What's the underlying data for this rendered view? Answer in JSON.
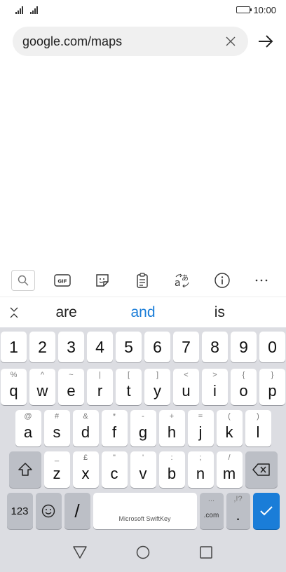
{
  "status_bar": {
    "time": "10:00"
  },
  "browser": {
    "url": "google.com/maps"
  },
  "suggestions": [
    "are",
    "and",
    "is"
  ],
  "keyboard": {
    "numbers": [
      "1",
      "2",
      "3",
      "4",
      "5",
      "6",
      "7",
      "8",
      "9",
      "0"
    ],
    "row1": [
      {
        "hint": "%",
        "key": "q"
      },
      {
        "hint": "^",
        "key": "w"
      },
      {
        "hint": "~",
        "key": "e"
      },
      {
        "hint": "|",
        "key": "r"
      },
      {
        "hint": "[",
        "key": "t"
      },
      {
        "hint": "]",
        "key": "y"
      },
      {
        "hint": "<",
        "key": "u"
      },
      {
        "hint": ">",
        "key": "i"
      },
      {
        "hint": "{",
        "key": "o"
      },
      {
        "hint": "}",
        "key": "p"
      }
    ],
    "row2": [
      {
        "hint": "@",
        "key": "a"
      },
      {
        "hint": "#",
        "key": "s"
      },
      {
        "hint": "&",
        "key": "d"
      },
      {
        "hint": "*",
        "key": "f"
      },
      {
        "hint": "-",
        "key": "g"
      },
      {
        "hint": "+",
        "key": "h"
      },
      {
        "hint": "=",
        "key": "j"
      },
      {
        "hint": "(",
        "key": "k"
      },
      {
        "hint": ")",
        "key": "l"
      }
    ],
    "row3": [
      {
        "hint": "_",
        "key": "z"
      },
      {
        "hint": "£",
        "key": "x"
      },
      {
        "hint": "\"",
        "key": "c"
      },
      {
        "hint": "'",
        "key": "v"
      },
      {
        "hint": ":",
        "key": "b"
      },
      {
        "hint": ";",
        "key": "n"
      },
      {
        "hint": "/",
        "key": "m"
      }
    ],
    "numbers_key": "123",
    "slash_key": "/",
    "space_label": "Microsoft SwiftKey",
    "dotcom_hint": "...",
    "dotcom_label": ".com",
    "dot_hint": ",!?",
    "dot_label": "."
  },
  "colors": {
    "accent": "#1a7dd8",
    "keyboard_bg": "#dcdde2",
    "url_bar_bg": "#f0f0f0"
  }
}
